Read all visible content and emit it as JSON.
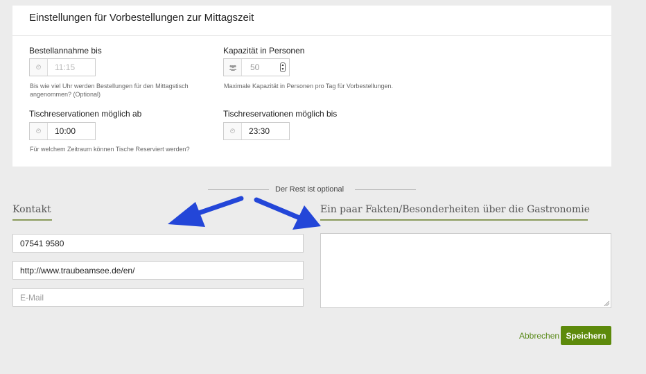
{
  "panel": {
    "title": "Einstellungen für Vorbestellungen zur Mittagszeit",
    "fields": {
      "order_until": {
        "label": "Bestellannahme bis",
        "value": "11:15",
        "help": "Bis wie viel Uhr werden Bestellungen für den Mittagstisch angenommen? (Optional)",
        "icon": "clock-icon"
      },
      "capacity": {
        "label": "Kapazität in Personen",
        "value": "50",
        "help": "Maximale Kapazität in Personen pro Tag für Vorbestellungen.",
        "icon": "users-icon"
      },
      "reservation_from": {
        "label": "Tischreservationen möglich ab",
        "value": "10:00",
        "help": "Für welchem Zeitraum können Tische Reserviert werden?",
        "icon": "clock-icon"
      },
      "reservation_until": {
        "label": "Tischreservationen möglich bis",
        "value": "23:30",
        "icon": "clock-icon"
      }
    }
  },
  "divider": {
    "text": "Der Rest ist optional"
  },
  "contact": {
    "title": "Kontakt",
    "phone": "07541 9580",
    "website": "http://www.traubeamsee.de/en/",
    "email_placeholder": "E-Mail"
  },
  "facts": {
    "title": "Ein paar Fakten/Besonderheiten über die Gastronomie",
    "value": ""
  },
  "actions": {
    "cancel": "Abbrechen",
    "save": "Speichern"
  },
  "colors": {
    "accent": "#5d8a0b",
    "underline": "#8a9a5b",
    "arrow": "#2346d8"
  }
}
